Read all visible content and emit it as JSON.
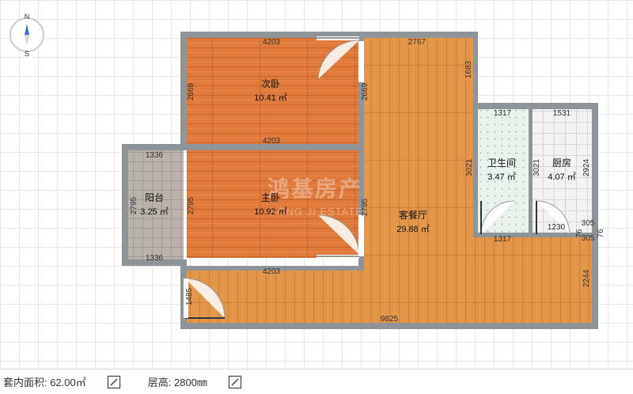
{
  "compass": {
    "north": "N",
    "south": "S"
  },
  "rooms": {
    "second_bedroom": {
      "name": "次卧",
      "area": "10.41 ㎡"
    },
    "master_bedroom": {
      "name": "主卧",
      "area": "10.92 ㎡"
    },
    "balcony": {
      "name": "阳台",
      "area": "3.25 ㎡"
    },
    "living_dining": {
      "name": "客餐厅",
      "area": "29.88 ㎡"
    },
    "bathroom": {
      "name": "卫生间",
      "area": "3.47 ㎡"
    },
    "kitchen": {
      "name": "厨房",
      "area": "4.07 ㎡"
    }
  },
  "dimensions": {
    "d4203_top": "4203",
    "d2767": "2767",
    "d1683": "1683",
    "d2669_left": "2669",
    "d2669_right": "2669",
    "d4203_mid": "4203",
    "d1336_top": "1336",
    "d1336_bottom": "1336",
    "d2795_balcony": "2795",
    "d2795_master": "2795",
    "d2795_right": "2795",
    "d4203_bottom": "4203",
    "d1317_top": "1317",
    "d1531": "1531",
    "d3021_bath": "3021",
    "d3021_kitchen": "3021",
    "d2924": "2924",
    "d1317_bottom": "1317",
    "d1230": "1230",
    "d305_a": "305",
    "d305_b": "305",
    "d76_a": "76",
    "d76_b": "76",
    "d1485": "1485",
    "d9825": "9825",
    "d2244": "2244"
  },
  "watermark": {
    "cn": "鸿基房产",
    "en": "HONG JI ESTATE"
  },
  "bottom_bar": {
    "area_label": "套内面积: 62.00㎡",
    "height_label": "层高: 2800㎜"
  },
  "colors": {
    "wall": "#8e9498",
    "bedroom_floor": "#e07a3a",
    "living_floor": "#e3954a",
    "balcony_floor": "#b9b3ab",
    "bathroom_floor": "#e8f1ea",
    "kitchen_floor": "#f2f2f2"
  }
}
